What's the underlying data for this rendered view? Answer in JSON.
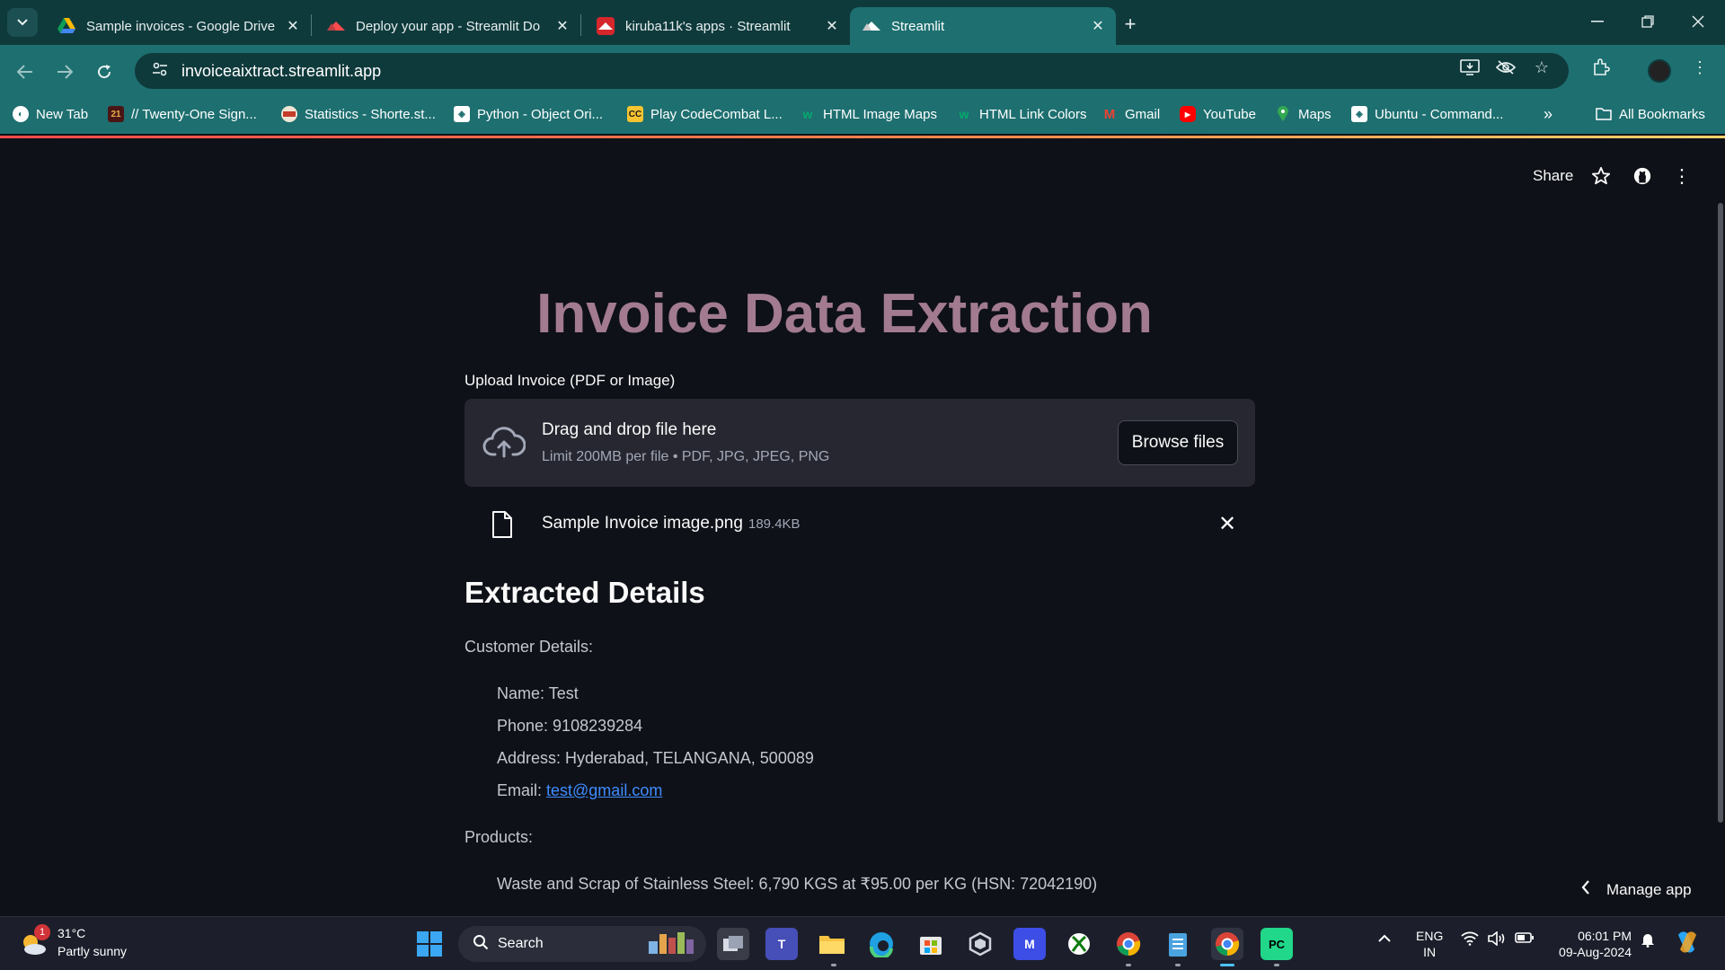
{
  "browser": {
    "tabs": [
      {
        "title": "Sample invoices - Google Drive",
        "icon": "google-drive-icon",
        "active": false
      },
      {
        "title": "Deploy your app - Streamlit Do",
        "icon": "streamlit-icon",
        "active": false
      },
      {
        "title": "kiruba11k's apps · Streamlit",
        "icon": "streamlit-icon",
        "active": false
      },
      {
        "title": "Streamlit",
        "icon": "streamlit-icon",
        "active": true
      }
    ],
    "url": "invoiceaixtract.streamlit.app",
    "bookmarks": [
      {
        "label": "New Tab",
        "icon": "globe-icon"
      },
      {
        "label": "// Twenty-One Sign...",
        "icon": "twenty-one-icon"
      },
      {
        "label": "Statistics - Shorte.st...",
        "icon": "shortest-icon"
      },
      {
        "label": "Python - Object Ori...",
        "icon": "python-icon"
      },
      {
        "label": "Play CodeCombat L...",
        "icon": "codecombat-icon"
      },
      {
        "label": "HTML Image Maps",
        "icon": "w3schools-icon"
      },
      {
        "label": "HTML Link Colors",
        "icon": "w3schools-icon"
      },
      {
        "label": "Gmail",
        "icon": "gmail-icon"
      },
      {
        "label": "YouTube",
        "icon": "youtube-icon"
      },
      {
        "label": "Maps",
        "icon": "maps-icon"
      },
      {
        "label": "Ubuntu - Command...",
        "icon": "ubuntu-icon"
      }
    ],
    "more_bookmarks": "»",
    "all_bookmarks": "All Bookmarks"
  },
  "app": {
    "share_label": "Share",
    "title": "Invoice Data Extraction",
    "upload_label": "Upload Invoice (PDF or Image)",
    "dropzone": {
      "main": "Drag and drop file here",
      "sub": "Limit 200MB per file • PDF, JPG, JPEG, PNG",
      "browse_label": "Browse files"
    },
    "uploaded_file": {
      "name": "Sample Invoice image.png",
      "size": "189.4KB"
    },
    "section_title": "Extracted Details",
    "customer_heading": "Customer Details:",
    "customer": {
      "name": "Name: Test",
      "phone": "Phone: 9108239284",
      "address": "Address: Hyderabad, TELANGANA, 500089",
      "email_label": "Email: ",
      "email": "test@gmail.com"
    },
    "products_heading": "Products:",
    "products": [
      "Waste and Scrap of Stainless Steel: 6,790 KGS at ₹95.00 per KG (HSN: 72042190)"
    ],
    "manage_label": "Manage app"
  },
  "taskbar": {
    "weather_badge": "1",
    "weather_temp": "31°C",
    "weather_desc": "Partly sunny",
    "search_label": "Search",
    "lang_top": "ENG",
    "lang_bottom": "IN",
    "time": "06:01 PM",
    "date": "09-Aug-2024"
  },
  "colors": {
    "title": "#a27b90",
    "tab_active": "#1e6f70",
    "tabstrip": "#0f3a3c",
    "app_bg": "#0e1117",
    "link": "#3f8cff"
  }
}
